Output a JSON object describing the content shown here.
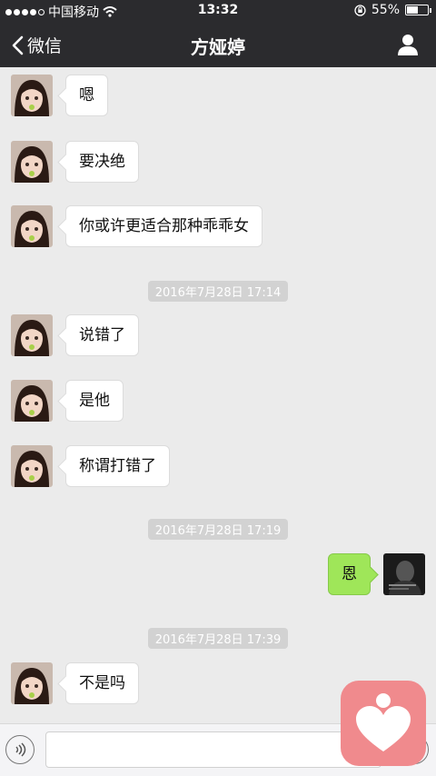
{
  "status": {
    "carrier": "中国移动",
    "time": "13:32",
    "battery": "55%",
    "battery_level": 0.55
  },
  "nav": {
    "back_label": "微信",
    "title": "方娅婷"
  },
  "messages": [
    {
      "side": "left",
      "text": "嗯"
    },
    {
      "side": "left",
      "text": "要决绝"
    },
    {
      "side": "left",
      "text": "你或许更适合那种乖乖女"
    },
    {
      "side": "left",
      "text": "说错了"
    },
    {
      "side": "left",
      "text": "是他"
    },
    {
      "side": "left",
      "text": "称谓打错了"
    },
    {
      "side": "right",
      "text": "恩"
    },
    {
      "side": "left",
      "text": "不是吗"
    }
  ],
  "timestamps": [
    "2016年7月28日 17:14",
    "2016年7月28日 17:19",
    "2016年7月28日 17:39"
  ],
  "colors": {
    "navbar": "#2b2b2e",
    "background": "#ebebeb",
    "own_bubble": "#9fe659",
    "floating_app": "#f08a8d"
  }
}
